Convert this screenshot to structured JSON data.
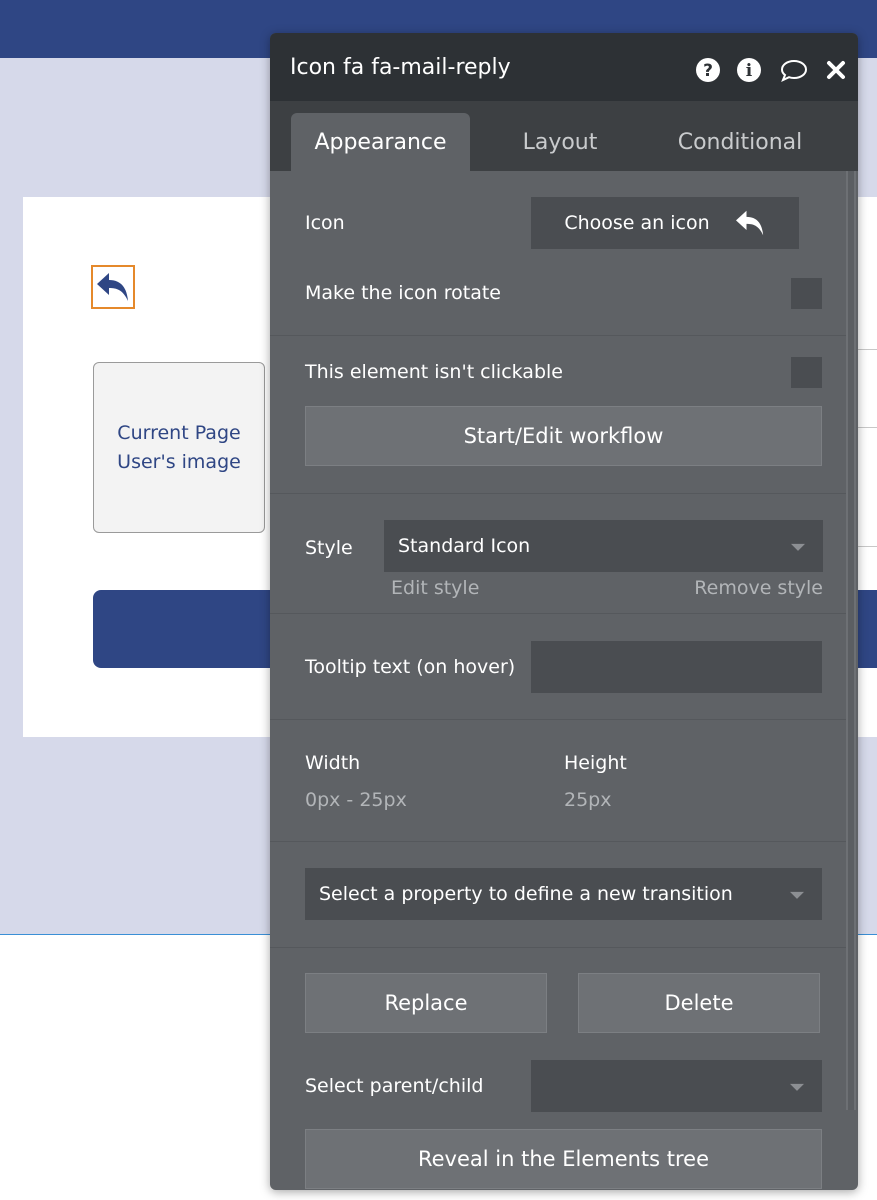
{
  "canvas": {
    "placeholder_lines": [
      "Current Page",
      "User's image"
    ]
  },
  "panel": {
    "title": "Icon fa fa-mail-reply",
    "header_icons": [
      "help-icon",
      "info-icon",
      "comment-icon",
      "close-icon"
    ],
    "tabs": [
      {
        "label": "Appearance",
        "active": true
      },
      {
        "label": "Layout",
        "active": false
      },
      {
        "label": "Conditional",
        "active": false
      }
    ],
    "icon_label": "Icon",
    "choose_icon_label": "Choose an icon",
    "rotate_label": "Make the icon rotate",
    "not_clickable_label": "This element isn't clickable",
    "workflow_button": "Start/Edit workflow",
    "style_label": "Style",
    "style_value": "Standard Icon",
    "edit_style": "Edit style",
    "remove_style": "Remove style",
    "tooltip_label": "Tooltip text (on hover)",
    "tooltip_value": "",
    "width_label": "Width",
    "width_value": "0px - 25px",
    "height_label": "Height",
    "height_value": "25px",
    "transition_placeholder": "Select a property to define a new transition",
    "replace_button": "Replace",
    "delete_button": "Delete",
    "parent_child_label": "Select parent/child",
    "parent_child_value": "",
    "reveal_button": "Reveal in the Elements tree"
  },
  "colors": {
    "brand_blue": "#2f4684",
    "selection_orange": "#e5892b",
    "panel_bg": "#5f6266",
    "panel_header": "#2d3135"
  }
}
